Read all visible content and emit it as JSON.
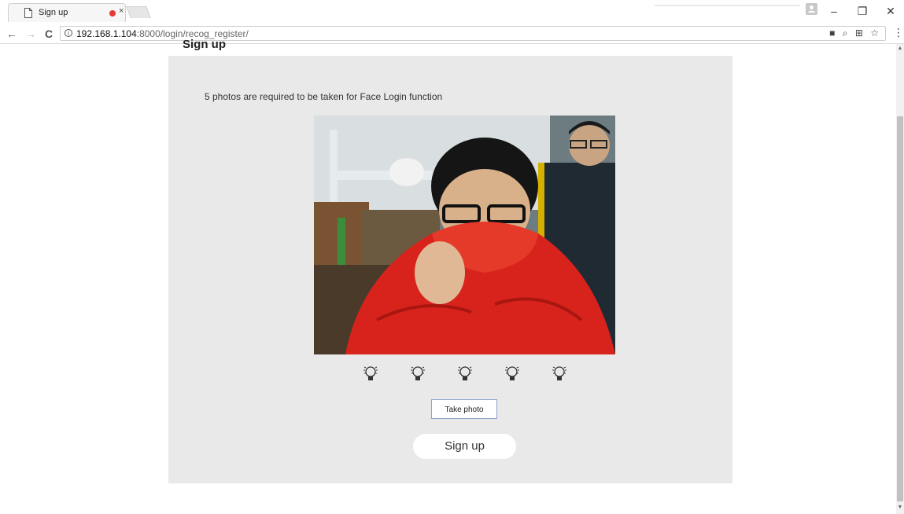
{
  "browser": {
    "tab_title": "Sign up",
    "tab_close": "×",
    "url_host": "192.168.1.104",
    "url_path": ":8000/login/recog_register/",
    "info_glyph": "i",
    "back_glyph": "←",
    "forward_glyph": "→",
    "reload_glyph": "C",
    "minimize_glyph": "–",
    "restore_glyph": "❐",
    "close_glyph": "✕",
    "menu_glyph": "⋮",
    "camera_glyph": "■",
    "zoom_glyph": "⌕",
    "translate_glyph": "⊞",
    "star_glyph": "☆"
  },
  "page": {
    "heading": "Sign up",
    "instruction": "5 photos are required to be taken for Face Login function",
    "take_photo_label": "Take photo",
    "signup_label": "Sign up",
    "photo_indicators": [
      "bulb-1",
      "bulb-2",
      "bulb-3",
      "bulb-4",
      "bulb-5"
    ],
    "photos_required": 5
  },
  "colors": {
    "panel_bg": "#e9e9e9",
    "recording_dot": "#e53935",
    "jacket_red": "#d8231c"
  }
}
